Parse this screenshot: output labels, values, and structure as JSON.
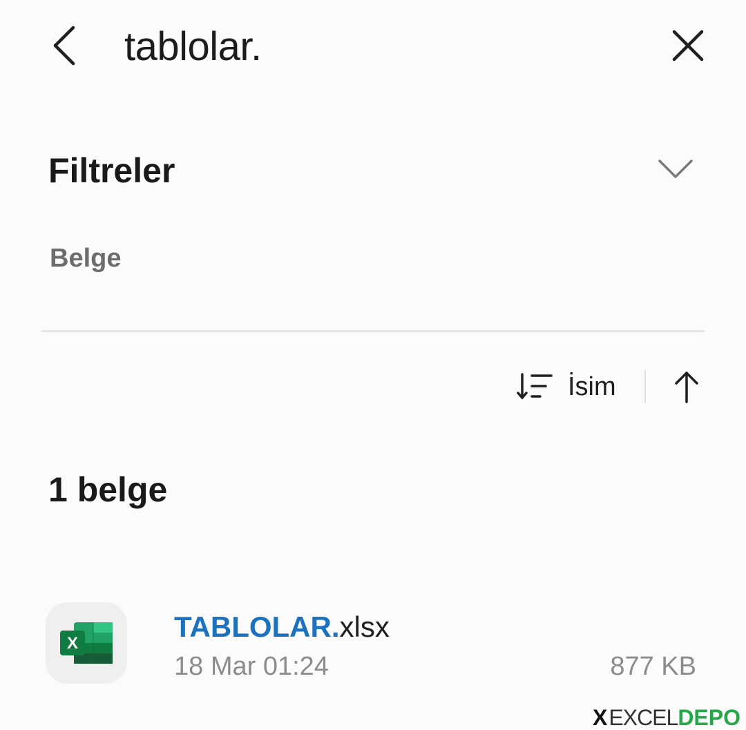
{
  "header": {
    "search_query": "tablolar.",
    "back_icon": "chevron-left-icon",
    "close_icon": "close-icon"
  },
  "filters": {
    "title": "Filtreler",
    "toggle_icon": "chevron-down-icon",
    "chip_label": "Belge"
  },
  "sort": {
    "icon": "sort-icon",
    "label": "İsim",
    "direction_icon": "arrow-up-icon"
  },
  "results": {
    "count_label": "1 belge",
    "files": [
      {
        "name_match": "TABLOLAR.",
        "name_rest": "xlsx",
        "date": "18 Mar 01:24",
        "size": "877 KB",
        "icon": "excel-file-icon"
      }
    ]
  },
  "watermark": {
    "x": "X",
    "excel": "EXCEL",
    "depo": "DEPO"
  },
  "colors": {
    "background": "#fbfbfb",
    "highlight": "#1d72c0",
    "secondary_text": "#8c8c8c",
    "excel_green": "#1f7a45"
  }
}
